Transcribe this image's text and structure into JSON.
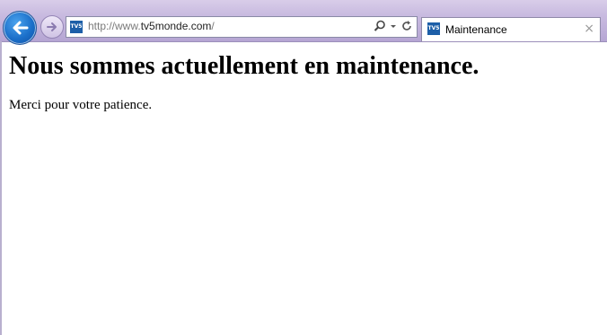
{
  "browser": {
    "address": {
      "url_prefix": "http://www.",
      "url_host": "tv5monde.com",
      "url_suffix": "/",
      "site_icon": "TV5"
    },
    "tab": {
      "label": "Maintenance",
      "site_icon": "TV5",
      "close_glyph": "×"
    },
    "icons": [
      "back-arrow-icon",
      "forward-arrow-icon",
      "search-icon",
      "dropdown-icon",
      "refresh-icon"
    ]
  },
  "page": {
    "heading": "Nous sommes actuellement en maintenance.",
    "message": "Merci pour votre patience."
  }
}
